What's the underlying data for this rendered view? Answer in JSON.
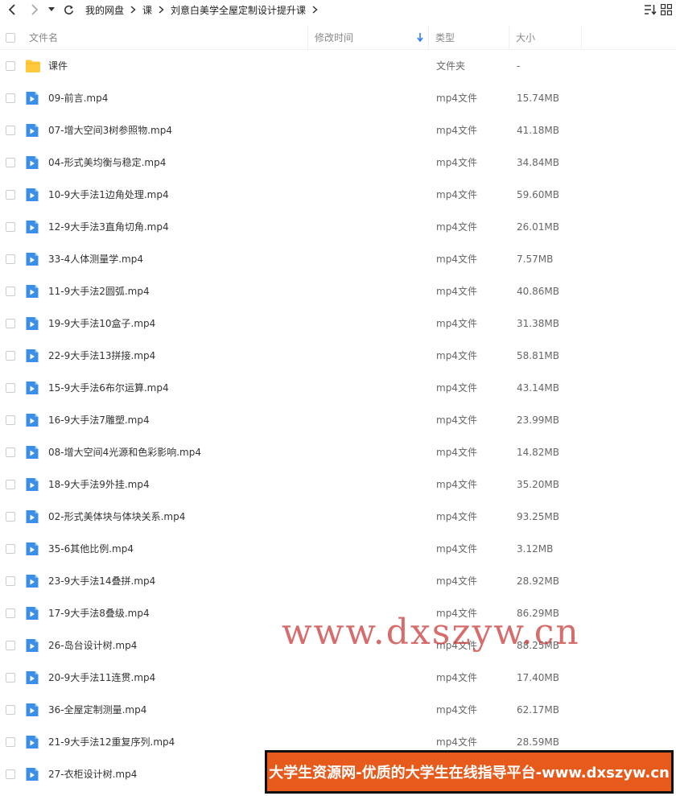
{
  "breadcrumb": [
    "我的网盘",
    "课",
    "刘意白美学全屋定制设计提升课"
  ],
  "columns": {
    "name": "文件名",
    "modified": "修改时间",
    "type": "类型",
    "size": "大小"
  },
  "files": [
    {
      "name": "课件",
      "type": "文件夹",
      "size": "-",
      "icon": "folder-icon"
    },
    {
      "name": "09-前言.mp4",
      "type": "mp4文件",
      "size": "15.74MB",
      "icon": "video-file-icon"
    },
    {
      "name": "07-增大空间3树参照物.mp4",
      "type": "mp4文件",
      "size": "41.18MB",
      "icon": "video-file-icon"
    },
    {
      "name": "04-形式美均衡与稳定.mp4",
      "type": "mp4文件",
      "size": "34.84MB",
      "icon": "video-file-icon"
    },
    {
      "name": "10-9大手法1边角处理.mp4",
      "type": "mp4文件",
      "size": "59.60MB",
      "icon": "video-file-icon"
    },
    {
      "name": "12-9大手法3直角切角.mp4",
      "type": "mp4文件",
      "size": "26.01MB",
      "icon": "video-file-icon"
    },
    {
      "name": "33-4人体测量学.mp4",
      "type": "mp4文件",
      "size": "7.57MB",
      "icon": "video-file-icon"
    },
    {
      "name": "11-9大手法2圆弧.mp4",
      "type": "mp4文件",
      "size": "40.86MB",
      "icon": "video-file-icon"
    },
    {
      "name": "19-9大手法10盒子.mp4",
      "type": "mp4文件",
      "size": "31.38MB",
      "icon": "video-file-icon"
    },
    {
      "name": "22-9大手法13拼接.mp4",
      "type": "mp4文件",
      "size": "58.81MB",
      "icon": "video-file-icon"
    },
    {
      "name": "15-9大手法6布尔运算.mp4",
      "type": "mp4文件",
      "size": "43.14MB",
      "icon": "video-file-icon"
    },
    {
      "name": "16-9大手法7雕塑.mp4",
      "type": "mp4文件",
      "size": "23.99MB",
      "icon": "video-file-icon"
    },
    {
      "name": "08-增大空间4光源和色彩影响.mp4",
      "type": "mp4文件",
      "size": "14.82MB",
      "icon": "video-file-icon"
    },
    {
      "name": "18-9大手法9外挂.mp4",
      "type": "mp4文件",
      "size": "35.20MB",
      "icon": "video-file-icon"
    },
    {
      "name": "02-形式美体块与体块关系.mp4",
      "type": "mp4文件",
      "size": "93.25MB",
      "icon": "video-file-icon"
    },
    {
      "name": "35-6其他比例.mp4",
      "type": "mp4文件",
      "size": "3.12MB",
      "icon": "video-file-icon"
    },
    {
      "name": "23-9大手法14叠拼.mp4",
      "type": "mp4文件",
      "size": "28.92MB",
      "icon": "video-file-icon"
    },
    {
      "name": "17-9大手法8叠级.mp4",
      "type": "mp4文件",
      "size": "86.29MB",
      "icon": "video-file-icon"
    },
    {
      "name": "26-岛台设计树.mp4",
      "type": "mp4文件",
      "size": "88.25MB",
      "icon": "video-file-icon"
    },
    {
      "name": "20-9大手法11连贯.mp4",
      "type": "mp4文件",
      "size": "17.40MB",
      "icon": "video-file-icon"
    },
    {
      "name": "36-全屋定制测量.mp4",
      "type": "mp4文件",
      "size": "62.17MB",
      "icon": "video-file-icon"
    },
    {
      "name": "21-9大手法12重复序列.mp4",
      "type": "mp4文件",
      "size": "28.59MB",
      "icon": "video-file-icon"
    },
    {
      "name": "27-衣柜设计树.mp4",
      "type": "",
      "size": "",
      "icon": "video-file-icon"
    }
  ],
  "watermark": "www.dxszyw.cn",
  "banner": "大学生资源网-优质的大学生在线指导平台-www.dxszyw.cn",
  "colors": {
    "folder": "#ffc93c",
    "video": "#3a8ee6",
    "sort_arrow": "#2b7cf6",
    "banner_bg": "#e65a1c"
  }
}
